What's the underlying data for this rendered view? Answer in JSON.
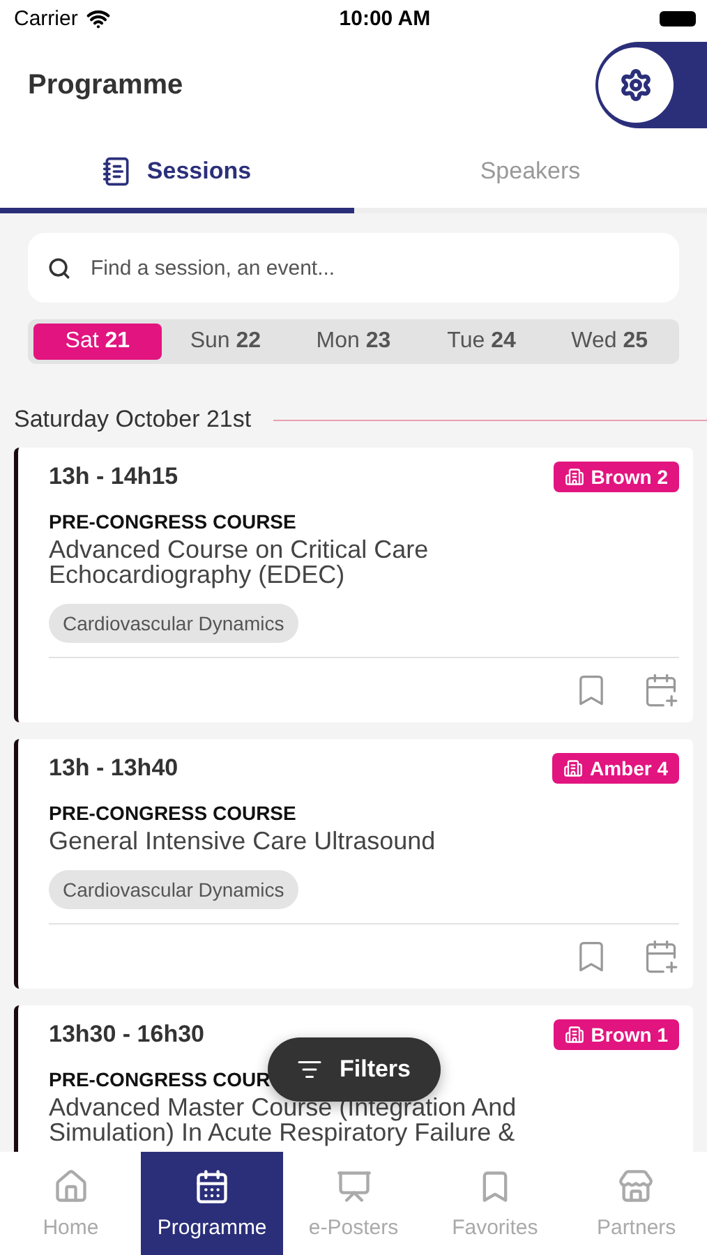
{
  "status_bar": {
    "carrier": "Carrier",
    "time": "10:00 AM"
  },
  "header": {
    "title": "Programme"
  },
  "tabs": [
    {
      "label": "Sessions",
      "selected": true
    },
    {
      "label": "Speakers",
      "selected": false
    }
  ],
  "search": {
    "placeholder": "Find a session, an event..."
  },
  "days": [
    {
      "day": "Sat",
      "date": "21",
      "selected": true
    },
    {
      "day": "Sun",
      "date": "22",
      "selected": false
    },
    {
      "day": "Mon",
      "date": "23",
      "selected": false
    },
    {
      "day": "Tue",
      "date": "24",
      "selected": false
    },
    {
      "day": "Wed",
      "date": "25",
      "selected": false
    }
  ],
  "section": {
    "title": "Saturday October 21st"
  },
  "sessions": [
    {
      "time": "13h - 14h15",
      "room": "Brown 2",
      "category": "PRE-CONGRESS COURSE",
      "title": "Advanced Course on Critical Care Echocardiography (EDEC)",
      "tag": "Cardiovascular Dynamics"
    },
    {
      "time": "13h - 13h40",
      "room": "Amber 4",
      "category": "PRE-CONGRESS COURSE",
      "title": "General Intensive Care Ultrasound",
      "tag": "Cardiovascular Dynamics"
    },
    {
      "time": "13h30 - 16h30",
      "room": "Brown 1",
      "category": "PRE-CONGRESS COUR",
      "title": "Advanced Master Course (Integration And Simulation) In Acute Respiratory Failure &"
    }
  ],
  "filters_button": {
    "label": "Filters"
  },
  "nav": [
    {
      "label": "Home",
      "kind": "home",
      "selected": false
    },
    {
      "label": "Programme",
      "kind": "programme",
      "selected": true
    },
    {
      "label": "e-Posters",
      "kind": "posters",
      "selected": false
    },
    {
      "label": "Favorites",
      "kind": "favorites",
      "selected": false
    },
    {
      "label": "Partners",
      "kind": "partners",
      "selected": false
    }
  ]
}
